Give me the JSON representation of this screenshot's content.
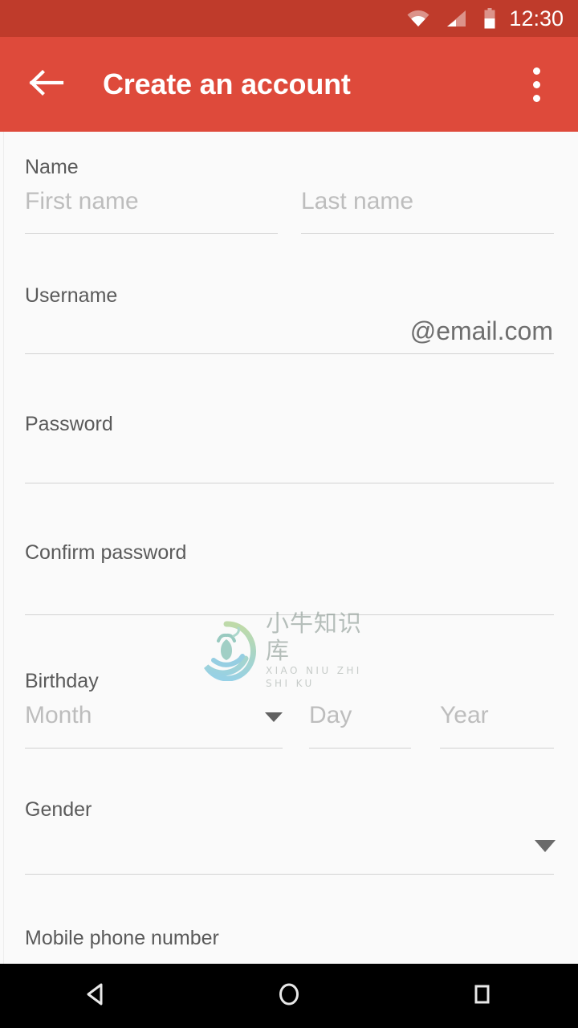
{
  "status_bar": {
    "time": "12:30",
    "background_color": "#BF3B2B",
    "icons": [
      "wifi-icon",
      "signal-icon",
      "battery-icon"
    ]
  },
  "app_bar": {
    "title": "Create an account",
    "background_color": "#DE4A3B",
    "back_icon": "arrow-left-icon",
    "overflow_icon": "more-vertical-icon"
  },
  "form": {
    "name": {
      "label": "Name",
      "first_name_placeholder": "First name",
      "first_name_value": "",
      "last_name_placeholder": "Last name",
      "last_name_value": ""
    },
    "username": {
      "label": "Username",
      "value": "",
      "domain_suffix": "@email.com"
    },
    "password": {
      "label": "Password",
      "value": ""
    },
    "confirm_password": {
      "label": "Confirm password",
      "value": ""
    },
    "birthday": {
      "label": "Birthday",
      "month_placeholder": "Month",
      "month_value": "",
      "day_placeholder": "Day",
      "day_value": "",
      "year_placeholder": "Year",
      "year_value": "",
      "dropdown_icon": "chevron-down-icon"
    },
    "gender": {
      "label": "Gender",
      "value": "",
      "dropdown_icon": "chevron-down-icon"
    },
    "mobile_phone": {
      "label": "Mobile phone number"
    }
  },
  "watermark": {
    "cn_text": "小牛知识库",
    "pinyin_text": "XIAO NIU ZHI SHI KU",
    "logo_icon": "ox-circle-logo-icon"
  },
  "nav_bar": {
    "back_icon": "nav-back-triangle-icon",
    "home_icon": "nav-home-circle-icon",
    "recents_icon": "nav-recents-square-icon"
  }
}
